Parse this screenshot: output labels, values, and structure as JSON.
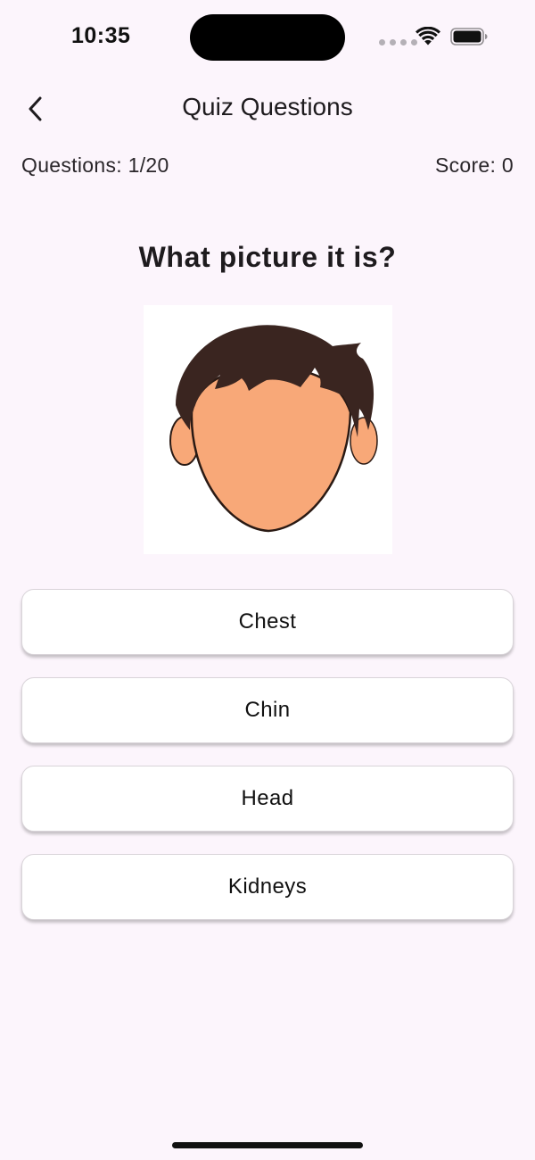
{
  "status_bar": {
    "time": "10:35"
  },
  "app_bar": {
    "title": "Quiz Questions",
    "back_icon": "chevron-left-icon"
  },
  "quiz": {
    "questions_label": "Questions: 1/20",
    "score_label": "Score: 0",
    "question": "What picture it is?",
    "image_description": "face-illustration",
    "answers": [
      "Chest",
      "Chin",
      "Head",
      "Kidneys"
    ]
  },
  "colors": {
    "background": "#fcf5fc",
    "hair": "#3a2520",
    "skin": "#f8a878"
  }
}
